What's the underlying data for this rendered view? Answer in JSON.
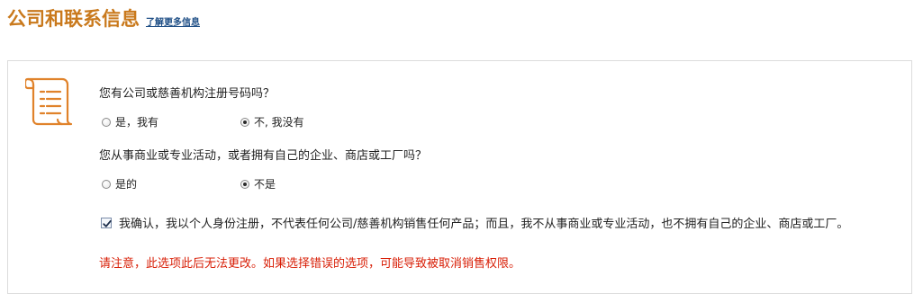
{
  "header": {
    "title": "公司和联系信息",
    "more_info_link": "了解更多信息"
  },
  "form": {
    "q1": {
      "question": "您有公司或慈善机构注册号码吗？",
      "options": [
        {
          "label": "是，我有",
          "selected": false
        },
        {
          "label": "不, 我没有",
          "selected": true
        }
      ]
    },
    "q2": {
      "question": "您从事商业或专业活动，或者拥有自己的企业、商店或工厂吗？",
      "options": [
        {
          "label": "是的",
          "selected": false
        },
        {
          "label": "不是",
          "selected": true
        }
      ]
    },
    "confirmation": {
      "checked": true,
      "text": "我确认，我以个人身份注册，不代表任何公司/慈善机构销售任何产品；而且，我不从事商业或专业活动，也不拥有自己的企业、商店或工厂。"
    },
    "warning": "请注意，此选项此后无法更改。如果选择错误的选项，可能导致被取消销售权限。"
  },
  "colors": {
    "title": "#c9791c",
    "icon": "#e0822a",
    "link": "#1f4f86",
    "warning": "#d81e06"
  },
  "icons": [
    "scroll-document-icon",
    "checkmark-icon"
  ]
}
